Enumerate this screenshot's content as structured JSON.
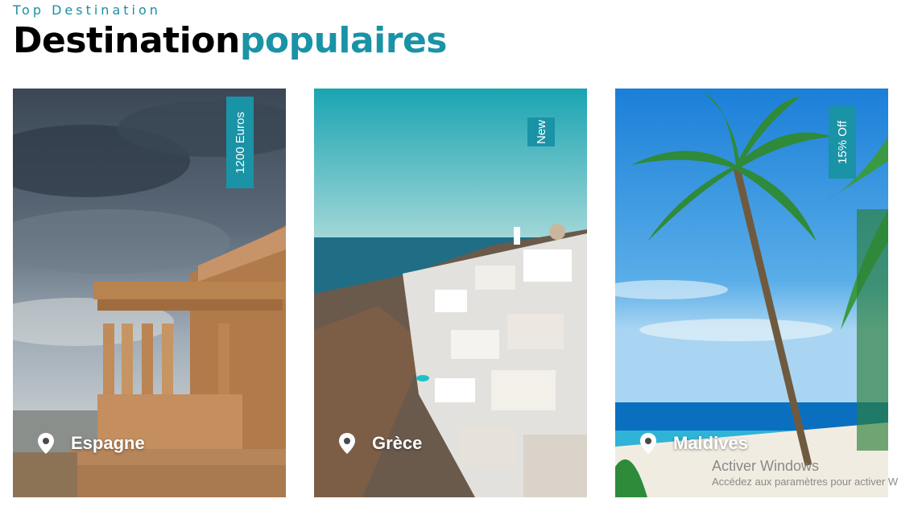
{
  "header": {
    "eyebrow": "Top Destination",
    "title_main": "Destination",
    "title_accent": "populaires"
  },
  "cards": [
    {
      "badge": "1200 Euros",
      "location": "Espagne",
      "image": "acropolis-temple-photo"
    },
    {
      "badge": "New",
      "location": "Grèce",
      "image": "santorini-village-photo"
    },
    {
      "badge": "15% Off",
      "location": "Maldives",
      "image": "palm-beach-photo"
    }
  ],
  "icons": {
    "location": "map-pin-icon"
  },
  "colors": {
    "accent": "#1a93a6",
    "text": "#000000"
  },
  "watermark": {
    "title": "Activer Windows",
    "subtitle": "Accédez aux paramètres pour activer W"
  }
}
